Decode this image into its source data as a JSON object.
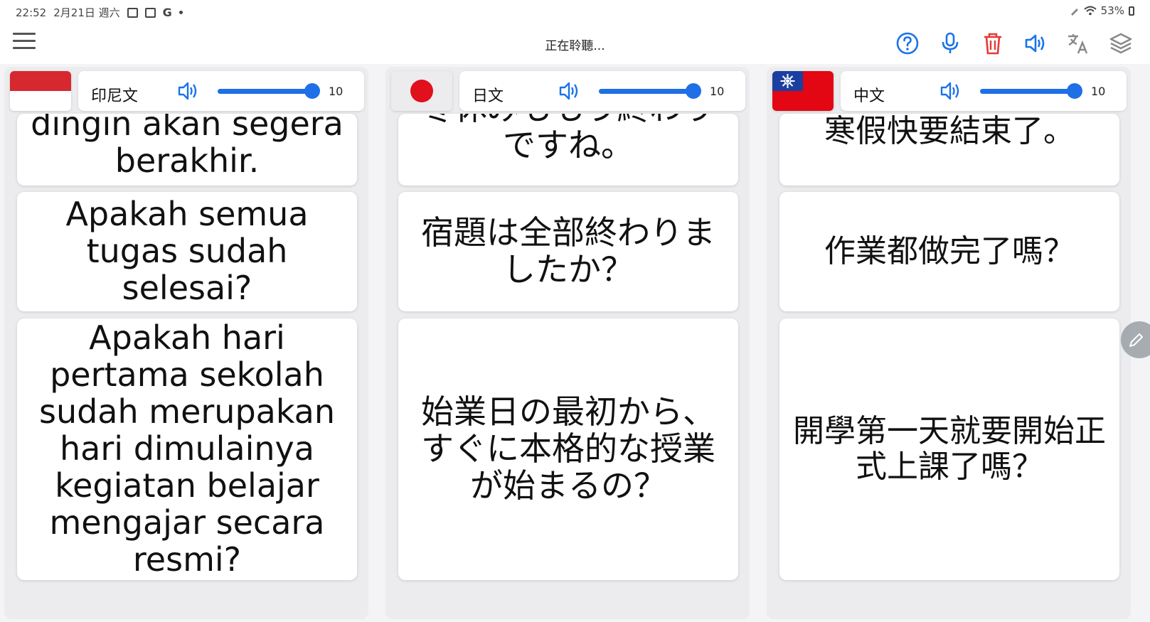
{
  "status_bar": {
    "time": "22:52",
    "date": "2月21日 週六",
    "notification_g": "G",
    "battery": "53%"
  },
  "toolbar": {
    "title": "正在聆聽...",
    "icons": [
      "help-icon",
      "microphone-icon",
      "trash-icon",
      "speaker-icon",
      "translate-icon",
      "layers-icon"
    ],
    "accent_color": "#1a73e8",
    "delete_color": "#e53935"
  },
  "columns": [
    {
      "language": "印尼文",
      "flag": "indonesia",
      "volume": "10",
      "cards": [
        "dingin akan segera berakhir.",
        "Apakah semua tugas sudah selesai?",
        "Apakah hari pertama sekolah sudah merupakan hari dimulainya kegiatan belajar mengajar secara resmi?"
      ]
    },
    {
      "language": "日文",
      "flag": "japan",
      "volume": "10",
      "cards": [
        "冬休みももう終わりですね。",
        "宿題は全部終わりましたか？",
        "始業日の最初から、すぐに本格的な授業が始まるの？"
      ]
    },
    {
      "language": "中文",
      "flag": "taiwan",
      "volume": "10",
      "cards": [
        "寒假快要結束了。",
        "作業都做完了嗎？",
        "開學第一天就要開始正式上課了嗎？"
      ]
    }
  ],
  "colors": {
    "slider": "#1f6fe6",
    "indonesia_red": "#d7282f",
    "japan_red": "#e0101c",
    "taiwan_red": "#e30613",
    "taiwan_blue": "#1b3fa0"
  }
}
